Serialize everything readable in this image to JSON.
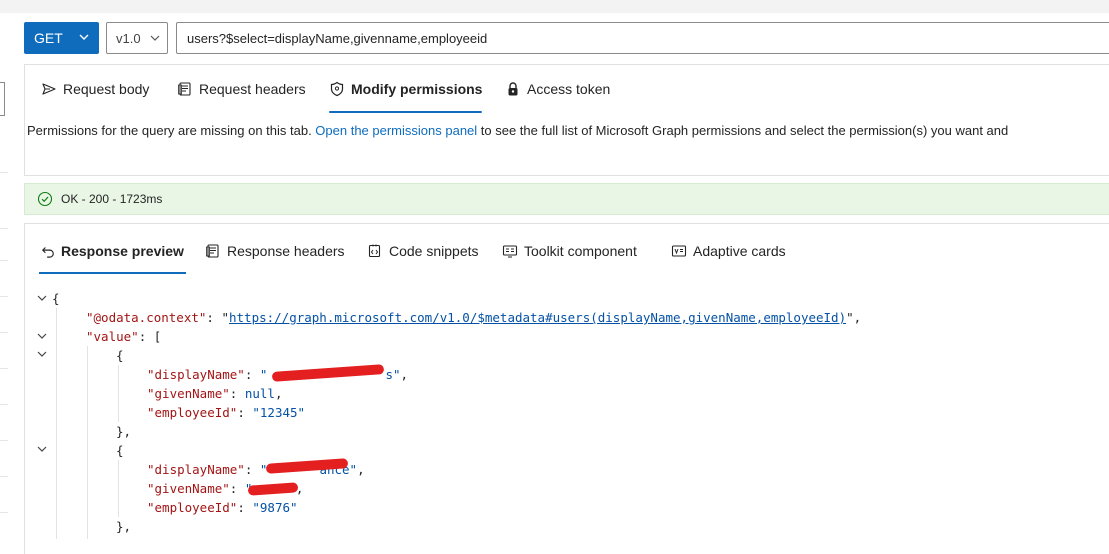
{
  "query": {
    "method": "GET",
    "version": "v1.0",
    "url": "users?$select=displayName,givenname,employeeid"
  },
  "request_tabs": [
    {
      "label": "Request body",
      "icon": "send-icon"
    },
    {
      "label": "Request headers",
      "icon": "headers-icon"
    },
    {
      "label": "Modify permissions",
      "icon": "shield-icon",
      "active": true
    },
    {
      "label": "Access token",
      "icon": "lock-icon"
    }
  ],
  "permissions": {
    "text_before": "Permissions for the query are missing on this tab. ",
    "link": "Open the permissions panel",
    "text_after": " to see the full list of Microsoft Graph permissions and select the permission(s) you want and"
  },
  "status": {
    "text": "OK - 200 - 1723ms",
    "color": "#107c10"
  },
  "response_tabs": [
    {
      "label": "Response preview",
      "icon": "undo-arrow-icon",
      "active": true
    },
    {
      "label": "Response headers",
      "icon": "headers-icon"
    },
    {
      "label": "Code snippets",
      "icon": "code-snippet-icon"
    },
    {
      "label": "Toolkit component",
      "icon": "toolkit-icon"
    },
    {
      "label": "Adaptive cards",
      "icon": "card-icon"
    }
  ],
  "response_json": {
    "context_key": "\"@odata.context\"",
    "context_value": "https://graph.microsoft.com/v1.0/$metadata#users(displayName,givenName,employeeId)",
    "value_key": "\"value\"",
    "items": [
      {
        "displayName_key": "\"displayName\"",
        "displayName_value_visible": "\"",
        "displayName_value_tail": "s\"",
        "givenName_key": "\"givenName\"",
        "givenName_value": "null",
        "employeeId_key": "\"employeeId\"",
        "employeeId_value": "\"12345\""
      },
      {
        "displayName_key": "\"displayName\"",
        "displayName_value_visible": "\"",
        "displayName_value_tail": "ance\"",
        "givenName_key": "\"givenName\"",
        "givenName_value_visible": "\"",
        "givenName_value_tail": "\"",
        "employeeId_key": "\"employeeId\"",
        "employeeId_value": "\"9876\""
      }
    ]
  },
  "colors": {
    "accent": "#0f6cbd",
    "status_bg": "#e9f6e6",
    "json_key": "#a31515",
    "json_value": "#0451a5",
    "redaction": "#e41f1f"
  }
}
